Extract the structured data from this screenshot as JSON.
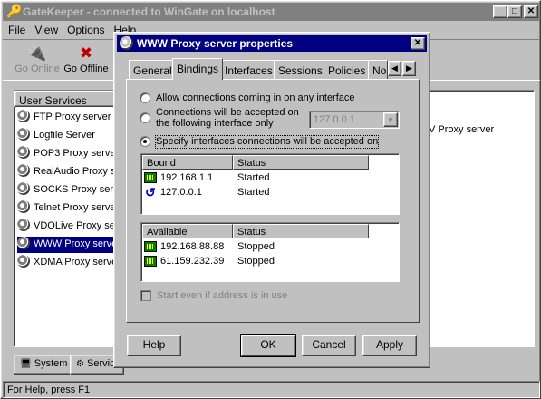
{
  "main": {
    "title": "GateKeeper - connected to WinGate on localhost",
    "menu": [
      "File",
      "View",
      "Options",
      "Help"
    ],
    "toolbar": {
      "go_online": "Go Online",
      "go_offline": "Go Offline"
    },
    "left_panel": {
      "header": "User Services",
      "items": [
        "FTP Proxy server",
        "Logfile Server",
        "POP3 Proxy server",
        "RealAudio Proxy server",
        "SOCKS Proxy server",
        "Telnet Proxy server",
        "VDOLive Proxy server",
        "WWW Proxy server",
        "XDMA Proxy server"
      ],
      "selected_index": 7
    },
    "right_panel_text": "V Proxy server",
    "bottom_tabs": [
      "System",
      "Services"
    ],
    "status": "For Help, press F1"
  },
  "dialog": {
    "title": "WWW Proxy server properties",
    "tabs": [
      "General",
      "Bindings",
      "Interfaces",
      "Sessions",
      "Policies",
      "Nor"
    ],
    "active_tab": "Bindings",
    "radios": {
      "any": "Allow connections coming in on any interface",
      "one_line1": "Connections will be accepted on",
      "one_line2": "the following interface only",
      "specify": "Specify interfaces connections will be accepted on"
    },
    "interface_value": "127.0.0.1",
    "bound": {
      "col1": "Bound",
      "col2": "Status",
      "rows": [
        {
          "ip": "192.168.1.1",
          "status": "Started"
        },
        {
          "ip": "127.0.0.1",
          "status": "Started"
        }
      ]
    },
    "available": {
      "col1": "Available",
      "col2": "Status",
      "rows": [
        {
          "ip": "192.168.88.88",
          "status": "Stopped"
        },
        {
          "ip": "61.159.232.39",
          "status": "Stopped"
        }
      ]
    },
    "checkbox": "Start even if address is in use",
    "buttons": {
      "help": "Help",
      "ok": "OK",
      "cancel": "Cancel",
      "apply": "Apply"
    }
  }
}
